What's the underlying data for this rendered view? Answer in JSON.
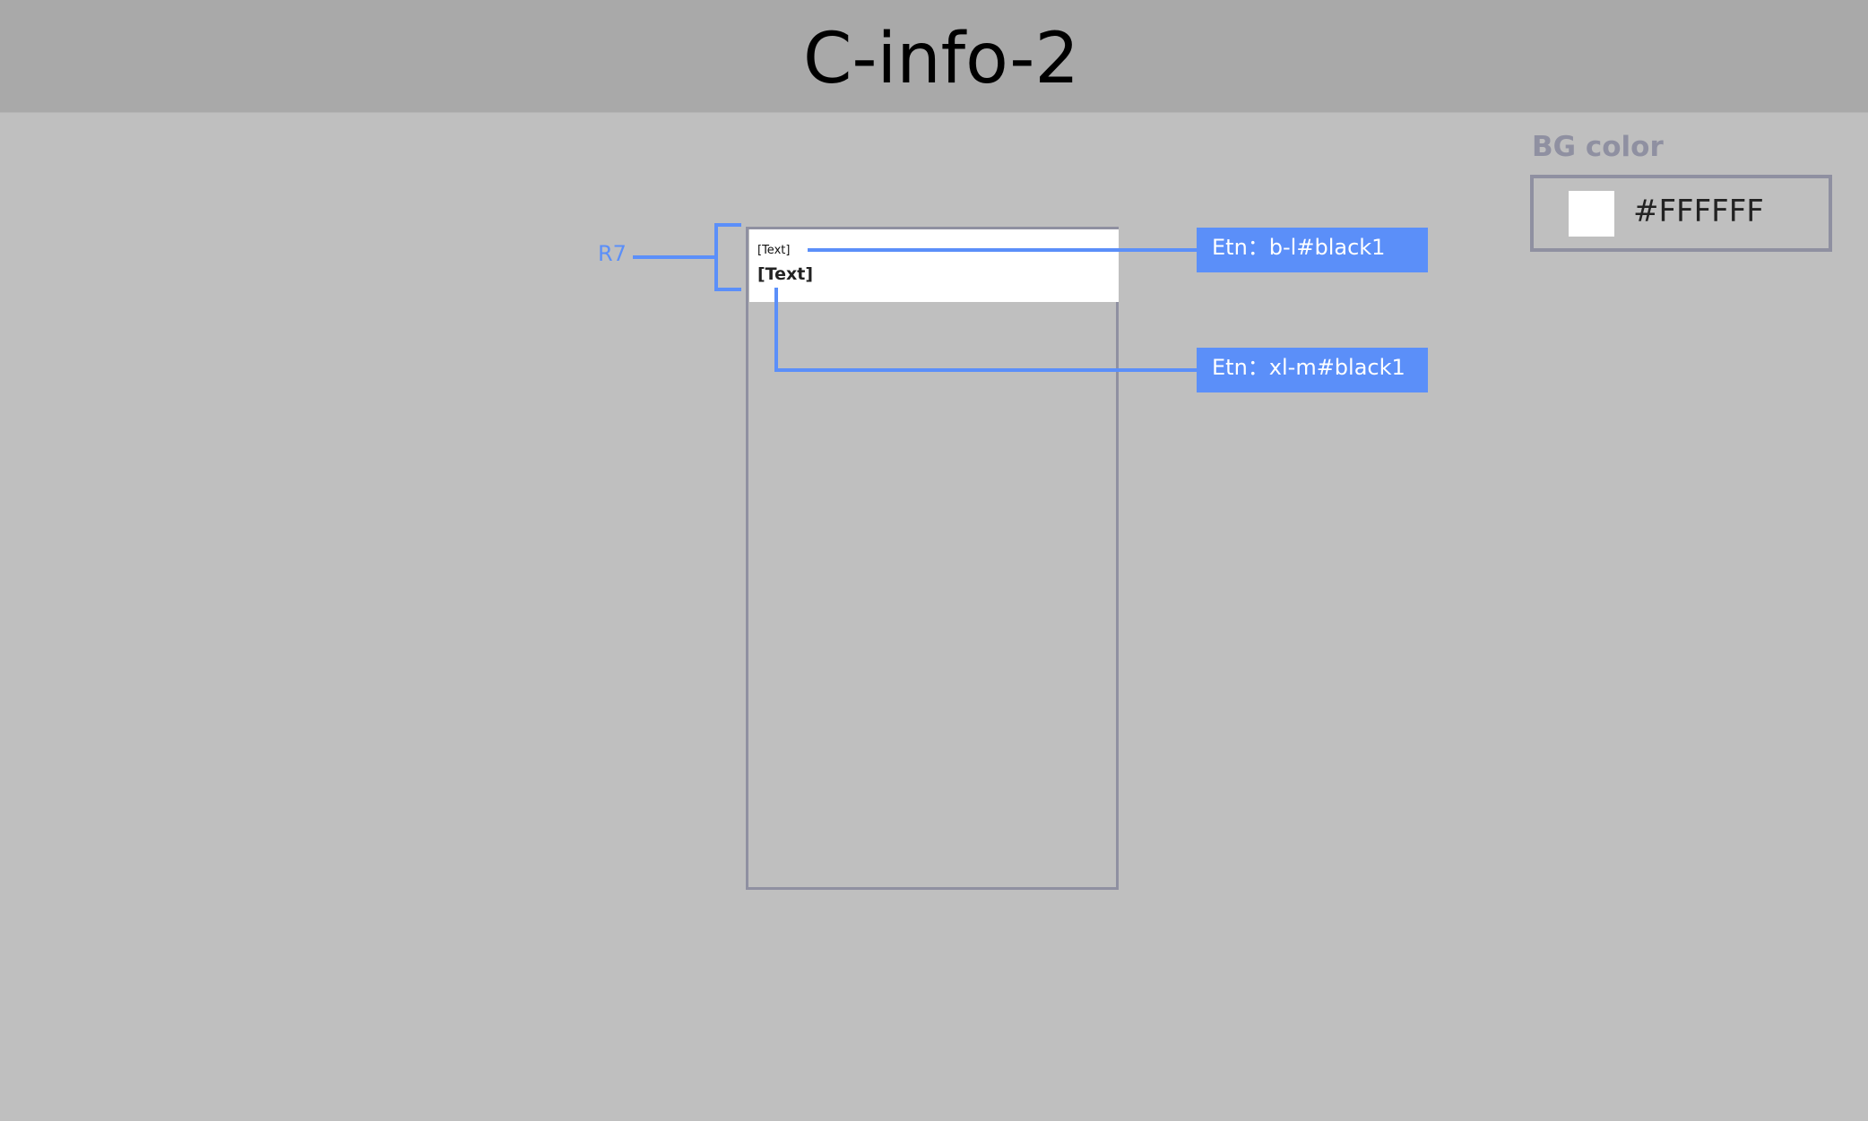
{
  "header": {
    "title": "C-info-2"
  },
  "component": {
    "text_small": "[Text]",
    "text_large": "[Text]"
  },
  "annotations": {
    "bracket_label": "R7",
    "small_text_style": "Etn：b-l#black1",
    "large_text_style": "Etn：xl-m#black1"
  },
  "bg": {
    "title": "BG color",
    "value": "#FFFFFF",
    "swatch_color": "#FFFFFF"
  },
  "colors": {
    "accent": "#5b8ff9",
    "frame": "#8f90a1",
    "background": "#bfbfbf",
    "header": "#a9a9a9"
  }
}
